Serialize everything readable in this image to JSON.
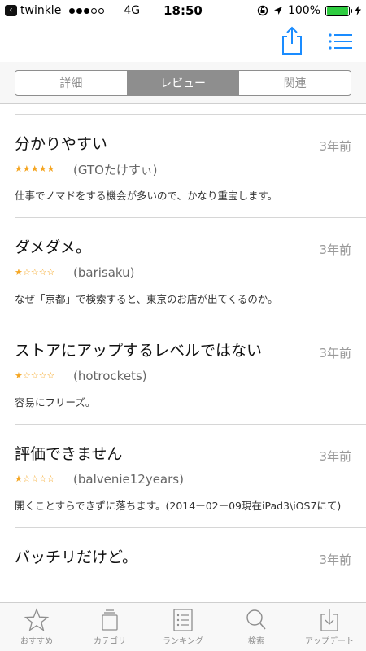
{
  "status": {
    "back_app": "twinkle",
    "network": "4G",
    "time": "18:50",
    "battery": "100%",
    "battery_level": 1.0
  },
  "segments": [
    {
      "label": "詳細",
      "active": false
    },
    {
      "label": "レビュー",
      "active": true
    },
    {
      "label": "関連",
      "active": false
    }
  ],
  "reviews": [
    {
      "title": "分かりやすい",
      "age": "3年前",
      "rating": 5,
      "author": "(GTOたけすぃ)",
      "body": "仕事でノマドをする機会が多いので、かなり重宝します。"
    },
    {
      "title": "ダメダメ。",
      "age": "3年前",
      "rating": 1,
      "author": "(barisaku)",
      "body": "なぜ「京都」で検索すると、東京のお店が出てくるのか。"
    },
    {
      "title": "ストアにアップするレベルではない",
      "age": "3年前",
      "rating": 1,
      "author": "(hotrockets)",
      "body": "容易にフリーズ。"
    },
    {
      "title": "評価できません",
      "age": "3年前",
      "rating": 1,
      "author": "(balvenie12years)",
      "body": "開くことすらできずに落ちます。(2014ー02ー09現在iPad3\\iOS7にて)"
    },
    {
      "title": "バッチリだけど。",
      "age": "3年前",
      "rating": 0,
      "author": "",
      "body": ""
    }
  ],
  "tabs": [
    {
      "label": "おすすめ",
      "icon": "star-icon"
    },
    {
      "label": "カテゴリ",
      "icon": "categories-icon"
    },
    {
      "label": "ランキング",
      "icon": "ranking-icon"
    },
    {
      "label": "検索",
      "icon": "search-icon"
    },
    {
      "label": "アップデート",
      "icon": "updates-icon"
    }
  ],
  "colors": {
    "accent": "#1a8cff",
    "star": "#f5a623",
    "segment": "#8e8e8e"
  }
}
